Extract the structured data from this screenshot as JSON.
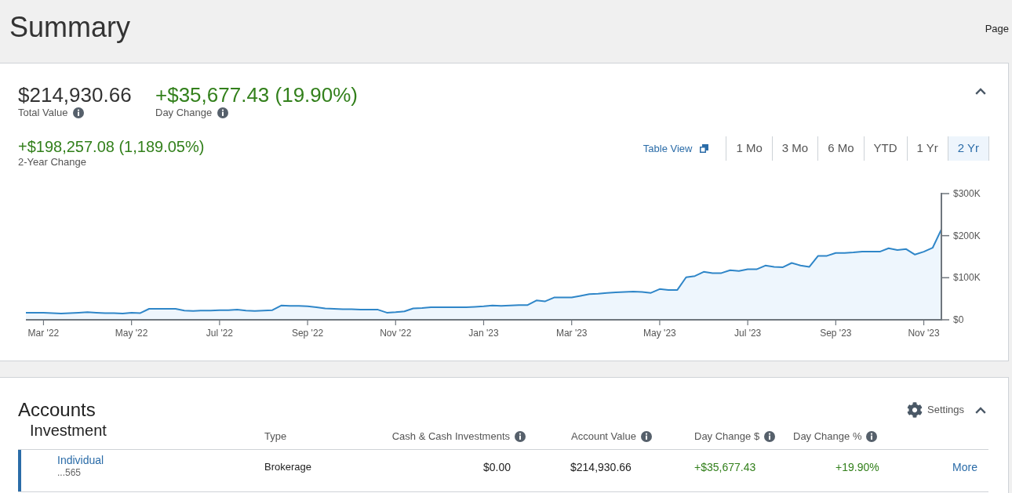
{
  "header": {
    "title": "Summary",
    "page_link": "Page"
  },
  "summary": {
    "expanded": true,
    "total_value": {
      "value": "$214,930.66",
      "label": "Total Value",
      "info": true
    },
    "day_change": {
      "value": "+$35,677.43 (19.90%)",
      "label": "Day Change",
      "info": true
    },
    "period_change": {
      "value": "+$198,257.08 (1,189.05%)",
      "label": "2-Year Change",
      "info": false
    },
    "table_view": "Table View",
    "ranges": [
      {
        "label": "1 Mo",
        "selected": false
      },
      {
        "label": "3 Mo",
        "selected": false
      },
      {
        "label": "6 Mo",
        "selected": false
      },
      {
        "label": "YTD",
        "selected": false
      },
      {
        "label": "1 Yr",
        "selected": false
      },
      {
        "label": "2 Yr",
        "selected": true
      }
    ],
    "chart_data": {
      "type": "area",
      "ylim": [
        0,
        300
      ],
      "yticks": [
        {
          "value": 0,
          "label": "$0"
        },
        {
          "value": 100,
          "label": "$100K"
        },
        {
          "value": 200,
          "label": "$200K"
        },
        {
          "value": 300,
          "label": "$300K"
        }
      ],
      "categories": [
        null,
        null,
        "Mar '22",
        null,
        null,
        null,
        null,
        null,
        null,
        null,
        null,
        null,
        "May '22",
        null,
        null,
        null,
        null,
        null,
        null,
        null,
        null,
        null,
        "Jul '22",
        null,
        null,
        null,
        null,
        null,
        null,
        null,
        null,
        null,
        "Sep '22",
        null,
        null,
        null,
        null,
        null,
        null,
        null,
        null,
        null,
        "Nov '22",
        null,
        null,
        null,
        null,
        null,
        null,
        null,
        null,
        null,
        "Jan '23",
        null,
        null,
        null,
        null,
        null,
        null,
        null,
        null,
        null,
        "Mar '23",
        null,
        null,
        null,
        null,
        null,
        null,
        null,
        null,
        null,
        "May '23",
        null,
        null,
        null,
        null,
        null,
        null,
        null,
        null,
        null,
        "Jul '23",
        null,
        null,
        null,
        null,
        null,
        null,
        null,
        null,
        null,
        "Sep '23",
        null,
        null,
        null,
        null,
        null,
        null,
        null,
        null,
        null,
        "Nov '23",
        null,
        null
      ],
      "series": [
        {
          "color": "#2f86c8",
          "values": [
            17,
            17,
            17,
            16,
            15,
            16,
            17,
            18,
            17,
            16,
            16,
            15,
            17,
            16,
            26,
            26,
            26,
            26,
            22,
            21,
            22,
            22,
            23,
            23,
            24,
            22,
            21,
            22,
            23,
            34,
            33,
            33,
            32,
            30,
            27,
            26,
            25,
            25,
            24,
            24,
            24,
            17,
            18,
            20,
            27,
            28,
            30,
            30,
            30,
            30,
            30,
            31,
            32,
            34,
            33,
            34,
            35,
            35,
            46,
            44,
            53,
            53,
            53,
            57,
            61,
            62,
            64,
            65,
            66,
            67,
            66,
            64,
            73,
            71,
            71,
            101,
            104,
            114,
            111,
            111,
            118,
            116,
            120,
            120,
            129,
            126,
            125,
            135,
            129,
            126,
            152,
            152,
            159,
            159,
            160,
            162,
            162,
            162,
            170,
            166,
            168,
            155,
            162,
            171,
            215
          ]
        }
      ]
    }
  },
  "accounts": {
    "title": "Accounts",
    "settings": "Settings",
    "expanded": true,
    "group": "Investment",
    "columns": [
      {
        "label": "Type",
        "info": false
      },
      {
        "label": "Cash & Cash Investments",
        "info": true
      },
      {
        "label": "Account Value",
        "info": true
      },
      {
        "label": "Day Change $",
        "info": true
      },
      {
        "label": "Day Change %",
        "info": true
      }
    ],
    "rows": [
      {
        "name": "Individual",
        "number": "...565",
        "type": "Brokerage",
        "cash": "$0.00",
        "account_value": "$214,930.66",
        "day_change": "+$35,677.43",
        "day_change_percent": "+19.90%",
        "action": "More"
      }
    ]
  }
}
